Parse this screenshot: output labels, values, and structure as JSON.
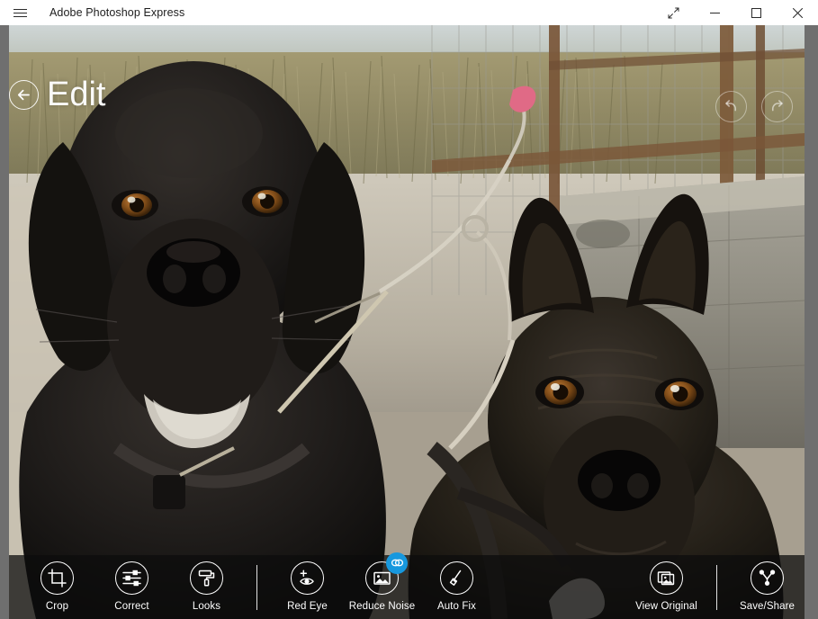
{
  "window": {
    "title": "Adobe Photoshop Express",
    "menu_icon": "hamburger-icon",
    "controls": [
      {
        "name": "restore-fullscreen-button",
        "icon": "diagonal-arrows-icon",
        "label": "Full screen"
      },
      {
        "name": "minimize-button",
        "icon": "minimize-icon",
        "label": "Minimize"
      },
      {
        "name": "maximize-button",
        "icon": "maximize-icon",
        "label": "Maximize"
      },
      {
        "name": "close-button",
        "icon": "close-icon",
        "label": "Close"
      }
    ]
  },
  "header": {
    "back_icon": "back-arrow-icon",
    "title": "Edit"
  },
  "history": {
    "undo_icon": "undo-icon",
    "redo_icon": "redo-icon"
  },
  "canvas": {
    "matte_color": "#6f6f6f",
    "photo_alt": "Two black dogs on leashes outdoors near a stone wall and wire fence"
  },
  "toolbar": {
    "background": "rgba(12,12,12,0.74)",
    "badge_color": "#1798DE",
    "left_tools": [
      {
        "name": "tool-crop",
        "label": "Crop",
        "icon": "crop-icon"
      },
      {
        "name": "tool-correct",
        "label": "Correct",
        "icon": "sliders-icon"
      },
      {
        "name": "tool-looks",
        "label": "Looks",
        "icon": "paint-roller-icon"
      }
    ],
    "mid_tools": [
      {
        "name": "tool-red-eye",
        "label": "Red Eye",
        "icon": "eye-plus-icon"
      },
      {
        "name": "tool-reduce-noise",
        "label": "Reduce Noise",
        "icon": "image-noise-icon",
        "badge": "link-badge-icon"
      },
      {
        "name": "tool-auto-fix",
        "label": "Auto Fix",
        "icon": "magic-wand-icon"
      }
    ],
    "right_tools": [
      {
        "name": "tool-view-original",
        "label": "View Original",
        "icon": "stacked-photos-icon"
      }
    ],
    "end_tools": [
      {
        "name": "tool-save-share",
        "label": "Save/Share",
        "icon": "share-icon"
      }
    ]
  }
}
